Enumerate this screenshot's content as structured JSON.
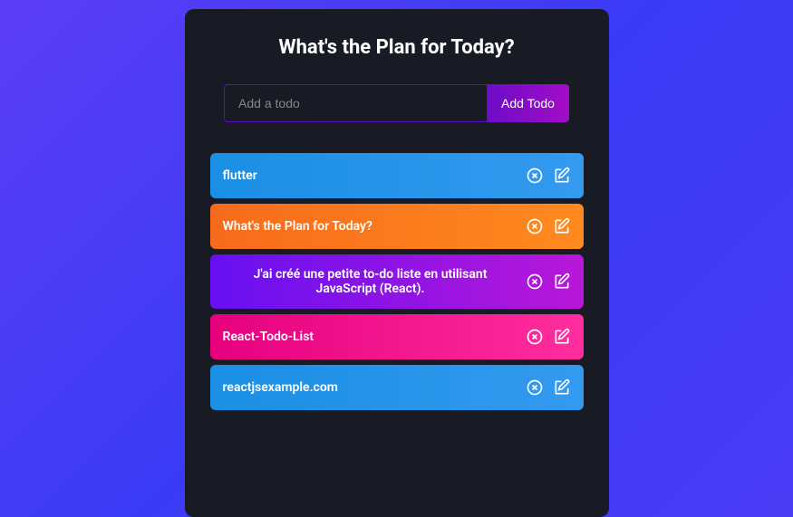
{
  "title": "What's the Plan for Today?",
  "form": {
    "placeholder": "Add a todo",
    "addButton": "Add Todo"
  },
  "todos": [
    {
      "text": "flutter",
      "gradient": "grad-blue"
    },
    {
      "text": "What's the Plan for Today?",
      "gradient": "grad-orange"
    },
    {
      "text": "J'ai créé une petite to-do liste en utilisant JavaScript (React).",
      "gradient": "grad-purple",
      "centered": true
    },
    {
      "text": "React-Todo-List",
      "gradient": "grad-pink"
    },
    {
      "text": "reactjsexample.com",
      "gradient": "grad-blue2"
    }
  ]
}
